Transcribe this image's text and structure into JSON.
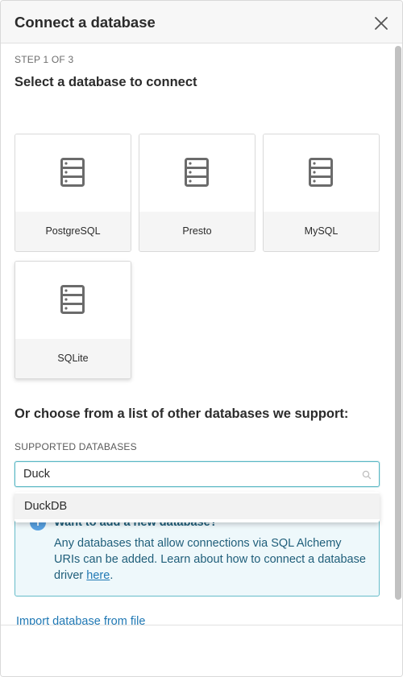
{
  "modal": {
    "title": "Connect a database",
    "step": "STEP 1 OF 3",
    "subtitle": "Select a database to connect"
  },
  "databases": [
    {
      "label": "PostgreSQL",
      "icon": "database-icon"
    },
    {
      "label": "Presto",
      "icon": "database-icon"
    },
    {
      "label": "MySQL",
      "icon": "database-icon"
    },
    {
      "label": "SQLite",
      "icon": "database-icon"
    }
  ],
  "other": {
    "heading": "Or choose from a list of other databases we support:",
    "field_label": "SUPPORTED DATABASES",
    "search_value": "Duck",
    "dropdown_options": [
      "DuckDB"
    ]
  },
  "alert": {
    "icon_glyph": "i",
    "title": "Want to add a new database?",
    "body": "Any databases that allow connections via SQL Alchemy URIs can be added. Learn about how to connect a database driver ",
    "link": "here",
    "suffix": "."
  },
  "footer": {
    "import_link": "Import database from file"
  },
  "colors": {
    "accent": "#5ab7c4",
    "info_bg": "#eef8fb",
    "info_border": "#66bcc9",
    "link": "#1f78b4"
  }
}
